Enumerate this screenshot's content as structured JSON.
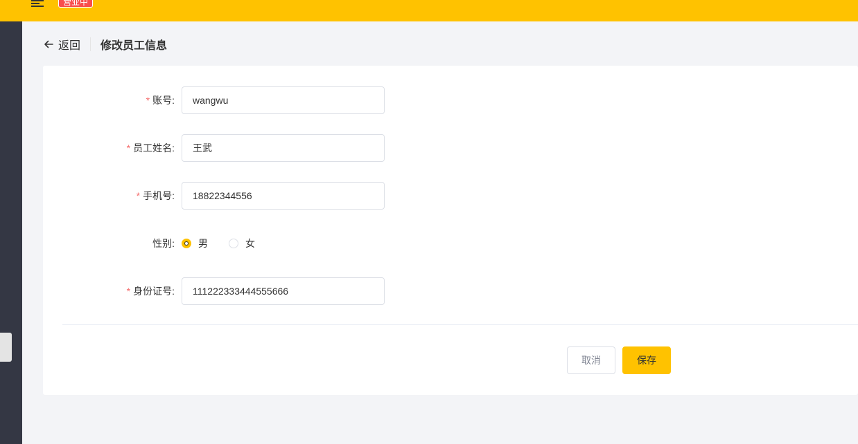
{
  "header": {
    "status_badge": "营业中",
    "accent_color": "#ffc200",
    "badge_color": "#f84e4e"
  },
  "page": {
    "back_label": "返回",
    "title": "修改员工信息"
  },
  "form": {
    "account": {
      "label": "账号:",
      "required": true,
      "value": "wangwu"
    },
    "name": {
      "label": "员工姓名:",
      "required": true,
      "value": "王武"
    },
    "phone": {
      "label": "手机号:",
      "required": true,
      "value": "18822344556"
    },
    "gender": {
      "label": "性别:",
      "options": [
        "男",
        "女"
      ],
      "selected": "男"
    },
    "id_number": {
      "label": "身份证号:",
      "required": true,
      "value": "111222333444555666"
    }
  },
  "actions": {
    "cancel_label": "取消",
    "save_label": "保存"
  },
  "icons": {
    "menu": "menu-fold-icon",
    "back": "arrow-left-icon"
  }
}
